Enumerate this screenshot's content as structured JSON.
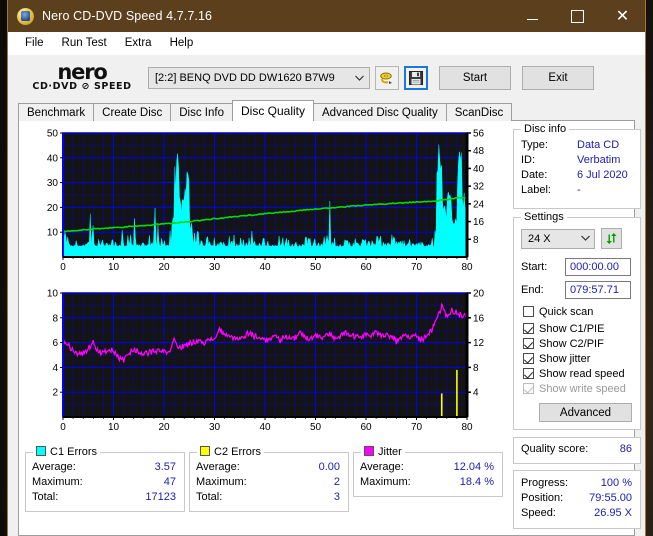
{
  "window": {
    "title": "Nero CD-DVD Speed 4.7.7.16",
    "app_icon": "nero-disc-icon",
    "minimize": "–",
    "maximize": "□",
    "close": "✕"
  },
  "menu": [
    "File",
    "Run Test",
    "Extra",
    "Help"
  ],
  "toolbar": {
    "logo_line1": "nero",
    "logo_line2": "CD·DVD ⊘ SPEED",
    "drive": "[2:2]   BENQ DVD DD DW1620 B7W9",
    "drive_chevron": "⌄",
    "eject_icon": "eject-disc-icon",
    "save_icon": "floppy-save-icon",
    "start_label": "Start",
    "exit_label": "Exit"
  },
  "tabs": [
    {
      "label": "Benchmark",
      "active": false
    },
    {
      "label": "Create Disc",
      "active": false
    },
    {
      "label": "Disc Info",
      "active": false
    },
    {
      "label": "Disc Quality",
      "active": true
    },
    {
      "label": "Advanced Disc Quality",
      "active": false
    },
    {
      "label": "ScanDisc",
      "active": false
    }
  ],
  "disc_info": {
    "title": "Disc info",
    "type_label": "Type:",
    "type_value": "Data CD",
    "id_label": "ID:",
    "id_value": "Verbatim",
    "date_label": "Date:",
    "date_value": "6 Jul 2020",
    "label_label": "Label:",
    "label_value": "-"
  },
  "settings": {
    "title": "Settings",
    "speed": "24 X",
    "speed_chevron": "⌄",
    "refresh_icon": "refresh-arrows-icon",
    "start_label": "Start:",
    "start_value": "000:00.00",
    "end_label": "End:",
    "end_value": "079:57.71",
    "checkboxes": [
      {
        "label": "Quick scan",
        "checked": false,
        "disabled": false
      },
      {
        "label": "Show C1/PIE",
        "checked": true,
        "disabled": false
      },
      {
        "label": "Show C2/PIF",
        "checked": true,
        "disabled": false
      },
      {
        "label": "Show jitter",
        "checked": true,
        "disabled": false
      },
      {
        "label": "Show read speed",
        "checked": true,
        "disabled": false
      },
      {
        "label": "Show write speed",
        "checked": true,
        "disabled": true
      }
    ],
    "advanced_label": "Advanced"
  },
  "quality": {
    "label": "Quality score:",
    "value": "86"
  },
  "status": {
    "progress_label": "Progress:",
    "progress_value": "100 %",
    "position_label": "Position:",
    "position_value": "79:55.00",
    "speed_label": "Speed:",
    "speed_value": "26.95 X"
  },
  "stats": [
    {
      "title": "C1 Errors",
      "color": "#00ffff",
      "rows": [
        {
          "k": "Average:",
          "v": "3.57"
        },
        {
          "k": "Maximum:",
          "v": "47"
        },
        {
          "k": "Total:",
          "v": "17123"
        }
      ]
    },
    {
      "title": "C2 Errors",
      "color": "#ffff00",
      "rows": [
        {
          "k": "Average:",
          "v": "0.00"
        },
        {
          "k": "Maximum:",
          "v": "2"
        },
        {
          "k": "Total:",
          "v": "3"
        }
      ]
    },
    {
      "title": "Jitter",
      "color": "#ff00ff",
      "rows": [
        {
          "k": "Average:",
          "v": "12.04 %"
        },
        {
          "k": "Maximum:",
          "v": "18.4 %"
        }
      ]
    }
  ],
  "chart_data": [
    {
      "type": "area",
      "name": "c1-errors-chart",
      "title": "",
      "xlabel": "",
      "ylabel": "C1 errors",
      "xlim": [
        0,
        80
      ],
      "ylim": [
        0,
        50
      ],
      "y2lim": [
        0,
        56
      ],
      "xticks": [
        0,
        10,
        20,
        30,
        40,
        50,
        60,
        70,
        80
      ],
      "yticks": [
        10,
        20,
        30,
        40,
        50
      ],
      "y2ticks": [
        8,
        16,
        24,
        32,
        40,
        48,
        56
      ],
      "grid": true,
      "bg": "#141414",
      "gridcolor": "#0000ff",
      "series": [
        {
          "name": "C1 errors",
          "color": "#00ffff",
          "kind": "spike-area",
          "x": [
            0,
            1,
            2,
            3,
            4,
            5,
            6,
            7,
            8,
            9,
            10,
            11,
            12,
            13,
            14,
            15,
            16,
            17,
            18,
            19,
            20,
            21,
            22,
            23,
            24,
            25,
            26,
            27,
            28,
            29,
            30,
            31,
            32,
            33,
            34,
            35,
            36,
            37,
            38,
            39,
            40,
            41,
            42,
            43,
            44,
            45,
            46,
            47,
            48,
            49,
            50,
            51,
            52,
            53,
            54,
            55,
            56,
            57,
            58,
            59,
            60,
            61,
            62,
            63,
            64,
            65,
            66,
            67,
            68,
            69,
            70,
            71,
            72,
            73,
            74,
            75,
            76,
            77,
            78,
            79,
            80
          ],
          "values": [
            16,
            8,
            9,
            11,
            7,
            21,
            10,
            20,
            9,
            13,
            8,
            12,
            14,
            9,
            18,
            10,
            7,
            9,
            23,
            11,
            14,
            19,
            44,
            27,
            36,
            14,
            17,
            9,
            13,
            8,
            11,
            8,
            9,
            15,
            7,
            12,
            8,
            11,
            9,
            12,
            10,
            9,
            13,
            8,
            11,
            7,
            10,
            9,
            12,
            8,
            10,
            9,
            25,
            11,
            8,
            10,
            9,
            12,
            8,
            11,
            9,
            10,
            13,
            8,
            11,
            24,
            9,
            12,
            8,
            10,
            9,
            11,
            8,
            12,
            48,
            22,
            34,
            16,
            54,
            30,
            18
          ],
          "baseline_avg": 3.57,
          "max": 47,
          "total": 17123
        },
        {
          "name": "Read speed",
          "color": "#00dd00",
          "kind": "line",
          "axis": "right",
          "x": [
            0,
            5,
            10,
            15,
            20,
            25,
            30,
            35,
            40,
            45,
            50,
            55,
            60,
            65,
            70,
            75,
            78,
            80
          ],
          "values": [
            11.5,
            12.5,
            13.2,
            14.0,
            15.0,
            16.0,
            17.3,
            18.4,
            19.6,
            20.6,
            21.6,
            22.6,
            23.4,
            24.2,
            24.8,
            25.6,
            26.6,
            26.95
          ]
        }
      ]
    },
    {
      "type": "line",
      "name": "jitter-c2-chart",
      "title": "",
      "xlabel": "",
      "ylabel": "C2 errors",
      "xlim": [
        0,
        80
      ],
      "ylim": [
        0,
        10
      ],
      "y2lim": [
        0,
        20
      ],
      "xticks": [
        0,
        10,
        20,
        30,
        40,
        50,
        60,
        70,
        80
      ],
      "yticks": [
        2,
        4,
        6,
        8,
        10
      ],
      "y2ticks": [
        4,
        8,
        12,
        16,
        20
      ],
      "grid": true,
      "bg": "#141414",
      "gridcolor": "#0000ff",
      "series": [
        {
          "name": "Jitter",
          "color": "#ff00ff",
          "kind": "line",
          "axis": "right",
          "x": [
            0,
            1,
            2,
            3,
            4,
            5,
            6,
            7,
            8,
            9,
            10,
            11,
            12,
            13,
            14,
            15,
            16,
            17,
            18,
            19,
            20,
            21,
            22,
            23,
            24,
            25,
            26,
            27,
            28,
            29,
            30,
            31,
            32,
            33,
            34,
            35,
            36,
            37,
            38,
            39,
            40,
            41,
            42,
            43,
            44,
            45,
            46,
            47,
            48,
            49,
            50,
            51,
            52,
            53,
            54,
            55,
            56,
            57,
            58,
            59,
            60,
            61,
            62,
            63,
            64,
            65,
            66,
            67,
            68,
            69,
            70,
            71,
            72,
            73,
            74,
            75,
            76,
            77,
            78,
            79,
            80
          ],
          "values": [
            12.6,
            11.6,
            10.8,
            10.2,
            10.3,
            11.0,
            12.1,
            10.5,
            10.4,
            10.9,
            10.6,
            9.6,
            9.2,
            10.3,
            11.0,
            10.4,
            10.3,
            10.4,
            10.6,
            10.5,
            10.6,
            10.2,
            12.4,
            11.2,
            11.4,
            11.8,
            12.2,
            12.4,
            12.0,
            12.4,
            12.6,
            14.2,
            13.0,
            12.9,
            12.8,
            12.6,
            13.2,
            13.6,
            13.0,
            12.8,
            12.4,
            12.5,
            13.0,
            12.4,
            13.2,
            12.6,
            12.8,
            13.5,
            13.0,
            12.6,
            13.2,
            12.8,
            13.0,
            13.4,
            12.6,
            13.0,
            13.6,
            13.2,
            12.8,
            13.0,
            13.4,
            13.0,
            13.6,
            13.2,
            13.4,
            13.0,
            12.2,
            12.6,
            13.4,
            12.8,
            13.2,
            12.4,
            13.0,
            14.0,
            15.6,
            17.8,
            16.2,
            17.2,
            16.8,
            16.4,
            16.0
          ],
          "average": 12.04,
          "max": 18.4
        },
        {
          "name": "C2 errors",
          "color": "#ffff00",
          "kind": "spike",
          "axis": "left",
          "x": [
            75,
            78
          ],
          "values": [
            1,
            2
          ],
          "average": 0.0,
          "max": 2,
          "total": 3
        }
      ]
    }
  ]
}
